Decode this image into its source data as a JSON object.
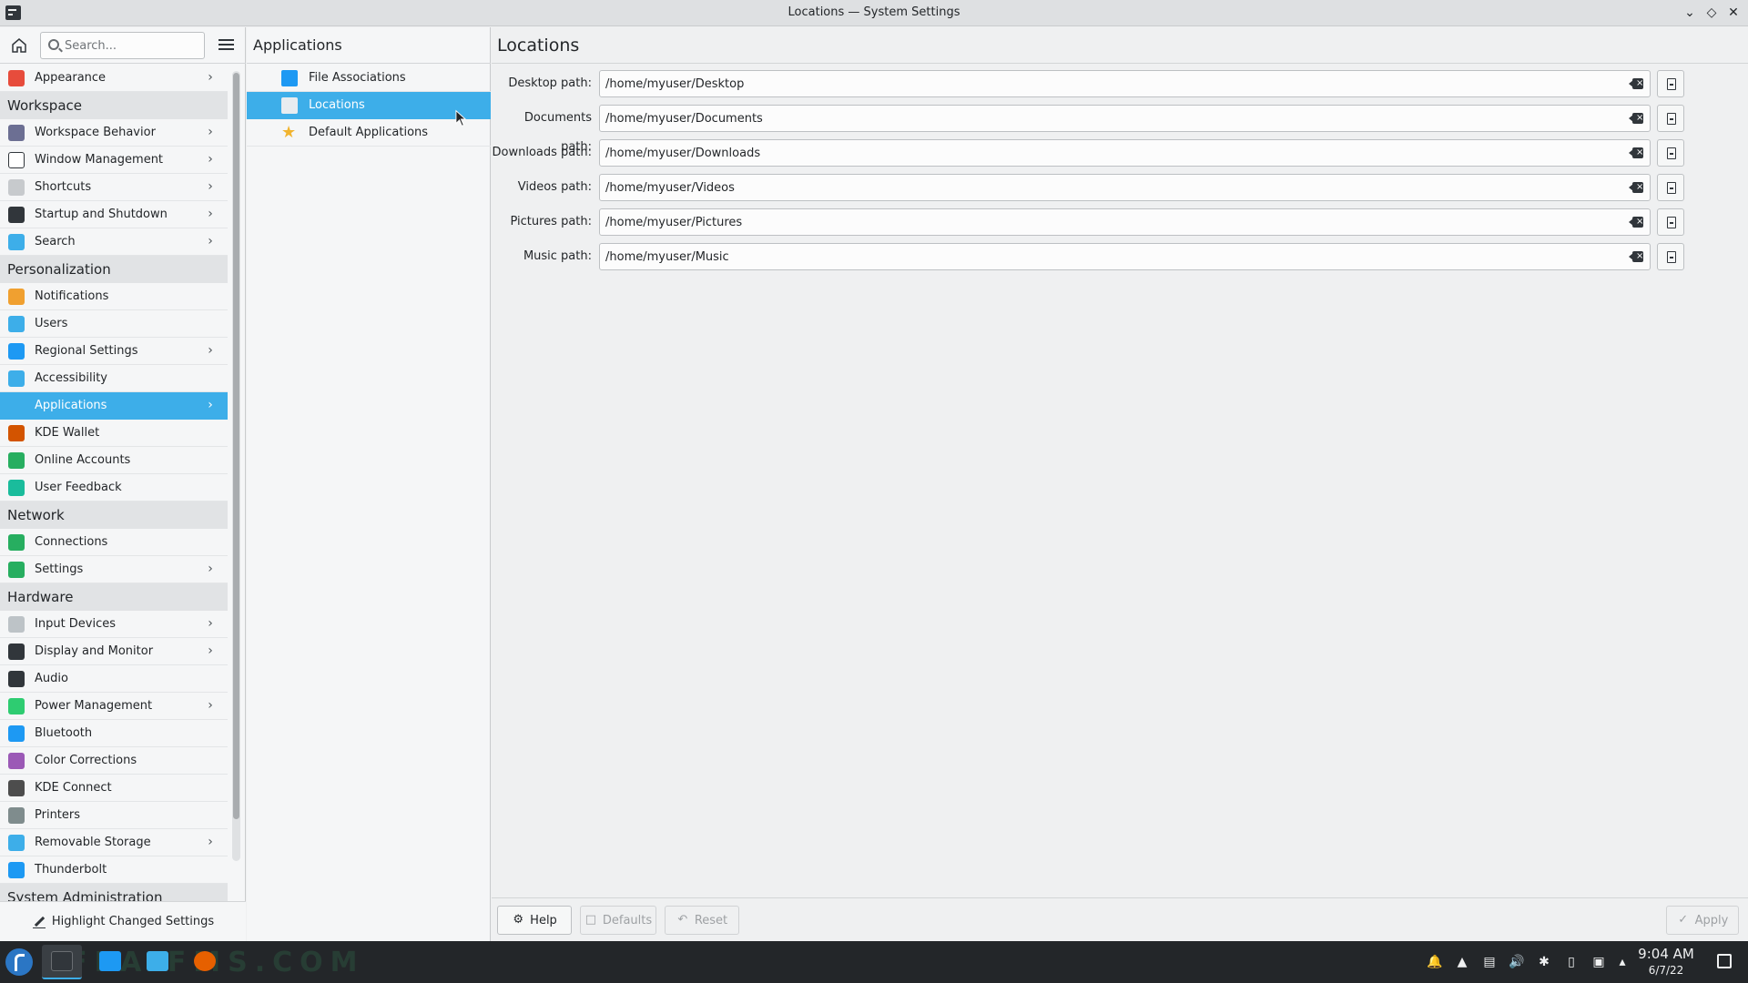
{
  "window": {
    "title": "Locations — System Settings",
    "controls": [
      "minimize",
      "maximize",
      "close"
    ]
  },
  "sidebar": {
    "search_placeholder": "Search...",
    "items": [
      {
        "type": "item",
        "label": "Appearance",
        "chevron": true,
        "icon": "appearance-icon",
        "color": "#e74c3c"
      },
      {
        "type": "section",
        "label": "Workspace"
      },
      {
        "type": "item",
        "label": "Workspace Behavior",
        "chevron": true,
        "icon": "workspace-behavior-icon",
        "color": "#6c6f93"
      },
      {
        "type": "item",
        "label": "Window Management",
        "chevron": true,
        "icon": "window-management-icon",
        "color": "#ffffff"
      },
      {
        "type": "item",
        "label": "Shortcuts",
        "chevron": true,
        "icon": "keyboard-icon",
        "color": "#c7cacd"
      },
      {
        "type": "item",
        "label": "Startup and Shutdown",
        "chevron": true,
        "icon": "startup-icon",
        "color": "#31363b"
      },
      {
        "type": "item",
        "label": "Search",
        "chevron": true,
        "icon": "search-icon",
        "color": "#3daee9"
      },
      {
        "type": "section",
        "label": "Personalization"
      },
      {
        "type": "item",
        "label": "Notifications",
        "chevron": false,
        "icon": "bell-icon",
        "color": "#f0a030"
      },
      {
        "type": "item",
        "label": "Users",
        "chevron": false,
        "icon": "users-icon",
        "color": "#3daee9"
      },
      {
        "type": "item",
        "label": "Regional Settings",
        "chevron": true,
        "icon": "regional-settings-icon",
        "color": "#1d99f3"
      },
      {
        "type": "item",
        "label": "Accessibility",
        "chevron": false,
        "icon": "accessibility-icon",
        "color": "#3daee9"
      },
      {
        "type": "item",
        "label": "Applications",
        "chevron": true,
        "icon": "applications-icon",
        "color": "#3daee9",
        "selected": true
      },
      {
        "type": "item",
        "label": "KDE Wallet",
        "chevron": false,
        "icon": "wallet-icon",
        "color": "#d35400"
      },
      {
        "type": "item",
        "label": "Online Accounts",
        "chevron": false,
        "icon": "online-accounts-icon",
        "color": "#27ae60"
      },
      {
        "type": "item",
        "label": "User Feedback",
        "chevron": false,
        "icon": "feedback-icon",
        "color": "#1abc9c"
      },
      {
        "type": "section",
        "label": "Network"
      },
      {
        "type": "item",
        "label": "Connections",
        "chevron": false,
        "icon": "connections-icon",
        "color": "#27ae60"
      },
      {
        "type": "item",
        "label": "Settings",
        "chevron": true,
        "icon": "network-settings-icon",
        "color": "#27ae60"
      },
      {
        "type": "section",
        "label": "Hardware"
      },
      {
        "type": "item",
        "label": "Input Devices",
        "chevron": true,
        "icon": "mouse-icon",
        "color": "#bdc3c7"
      },
      {
        "type": "item",
        "label": "Display and Monitor",
        "chevron": true,
        "icon": "monitor-icon",
        "color": "#31363b"
      },
      {
        "type": "item",
        "label": "Audio",
        "chevron": false,
        "icon": "speaker-icon",
        "color": "#31363b"
      },
      {
        "type": "item",
        "label": "Power Management",
        "chevron": true,
        "icon": "power-icon",
        "color": "#2ecc71"
      },
      {
        "type": "item",
        "label": "Bluetooth",
        "chevron": false,
        "icon": "bluetooth-icon",
        "color": "#1d99f3"
      },
      {
        "type": "item",
        "label": "Color Corrections",
        "chevron": false,
        "icon": "color-wheel-icon",
        "color": "#9b59b6"
      },
      {
        "type": "item",
        "label": "KDE Connect",
        "chevron": false,
        "icon": "phone-icon",
        "color": "#4d4d4d"
      },
      {
        "type": "item",
        "label": "Printers",
        "chevron": false,
        "icon": "printer-icon",
        "color": "#7f8c8d"
      },
      {
        "type": "item",
        "label": "Removable Storage",
        "chevron": true,
        "icon": "usb-icon",
        "color": "#3daee9"
      },
      {
        "type": "item",
        "label": "Thunderbolt",
        "chevron": false,
        "icon": "thunderbolt-icon",
        "color": "#1d99f3"
      },
      {
        "type": "section",
        "label": "System Administration"
      }
    ],
    "highlight_button": "Highlight Changed Settings"
  },
  "midcol": {
    "title": "Applications",
    "items": [
      {
        "label": "File Associations",
        "icon": "file-associations-icon",
        "color": "#1d99f3",
        "selected": false
      },
      {
        "label": "Locations",
        "icon": "folder-icon",
        "color": "#e8ecf0",
        "selected": true
      },
      {
        "label": "Default Applications",
        "icon": "star-icon",
        "color": "#f1b42f",
        "selected": false
      }
    ]
  },
  "main": {
    "title": "Locations",
    "fields": [
      {
        "label": "Desktop path:",
        "value": "/home/myuser/Desktop"
      },
      {
        "label": "Documents path:",
        "value": "/home/myuser/Documents"
      },
      {
        "label": "Downloads path:",
        "value": "/home/myuser/Downloads"
      },
      {
        "label": "Videos path:",
        "value": "/home/myuser/Videos"
      },
      {
        "label": "Pictures path:",
        "value": "/home/myuser/Pictures"
      },
      {
        "label": "Music path:",
        "value": "/home/myuser/Music"
      }
    ],
    "footer": {
      "help": "Help",
      "defaults": "Defaults",
      "reset": "Reset",
      "apply": "Apply"
    }
  },
  "taskbar": {
    "watermark": "LFEA-FMS.COM",
    "time": "9:04 AM",
    "date": "6/7/22",
    "tray_icons": [
      "notifications-tray-icon",
      "updates-tray-icon",
      "clipboard-tray-icon",
      "volume-tray-icon",
      "bluetooth-tray-icon",
      "battery-tray-icon",
      "network-tray-icon",
      "expand-tray-icon"
    ]
  }
}
